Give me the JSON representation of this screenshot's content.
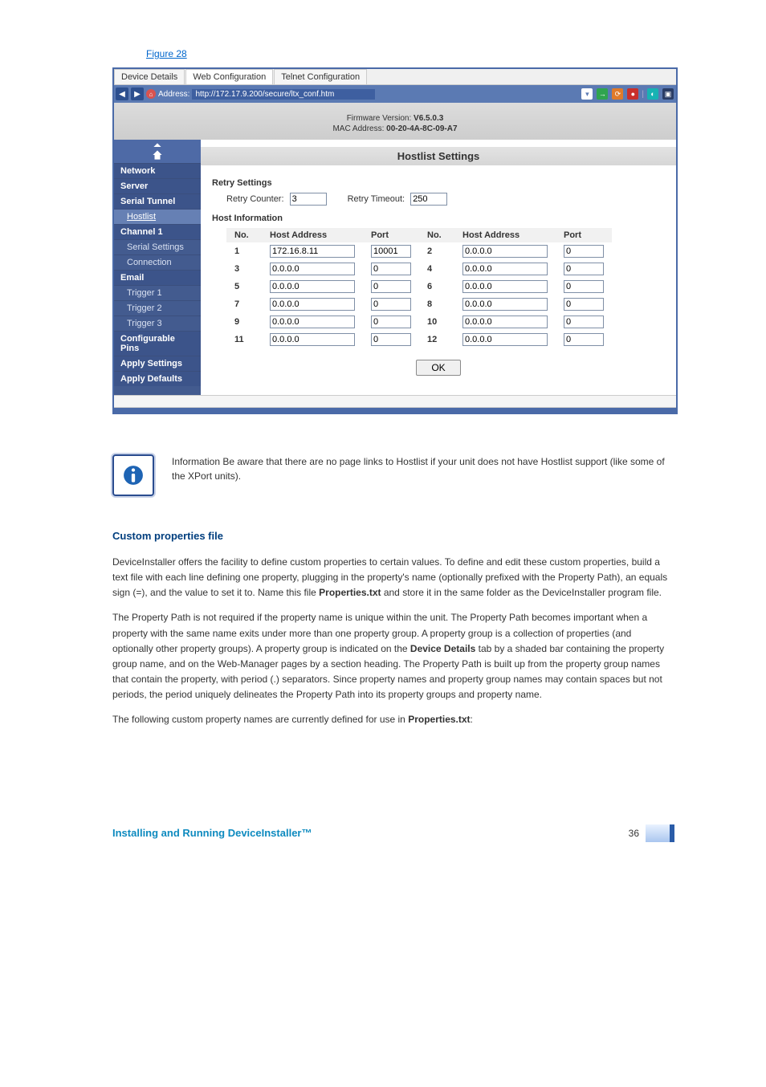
{
  "figure_link": "Figure 28",
  "tabs": {
    "device_details": "Device Details",
    "web_config": "Web Configuration",
    "telnet_config": "Telnet Configuration"
  },
  "addrbar": {
    "label": "Address:",
    "url": "http://172.17.9.200/secure/ltx_conf.htm"
  },
  "meta": {
    "fw_label": "Firmware Version:",
    "fw_value": "V6.5.0.3",
    "mac_label": "MAC Address:",
    "mac_value": "00-20-4A-8C-09-A7"
  },
  "section_title": "Hostlist Settings",
  "sidebar": {
    "network": "Network",
    "server": "Server",
    "serial_tunnel": "Serial Tunnel",
    "hostlist": "Hostlist",
    "channel1": "Channel 1",
    "serial_settings": "Serial Settings",
    "connection": "Connection",
    "email": "Email",
    "trigger1": "Trigger 1",
    "trigger2": "Trigger 2",
    "trigger3": "Trigger 3",
    "cfg_pins": "Configurable Pins",
    "apply_settings": "Apply Settings",
    "apply_defaults": "Apply Defaults"
  },
  "retry": {
    "title": "Retry Settings",
    "counter_label": "Retry Counter:",
    "counter_value": "3",
    "timeout_label": "Retry Timeout:",
    "timeout_value": "250"
  },
  "hostinfo": {
    "title": "Host Information",
    "cols": {
      "no": "No.",
      "ha": "Host Address",
      "port": "Port"
    },
    "rows": [
      {
        "no": "1",
        "ha": "172.16.8.11",
        "port": "10001"
      },
      {
        "no": "2",
        "ha": "0.0.0.0",
        "port": "0"
      },
      {
        "no": "3",
        "ha": "0.0.0.0",
        "port": "0"
      },
      {
        "no": "4",
        "ha": "0.0.0.0",
        "port": "0"
      },
      {
        "no": "5",
        "ha": "0.0.0.0",
        "port": "0"
      },
      {
        "no": "6",
        "ha": "0.0.0.0",
        "port": "0"
      },
      {
        "no": "7",
        "ha": "0.0.0.0",
        "port": "0"
      },
      {
        "no": "8",
        "ha": "0.0.0.0",
        "port": "0"
      },
      {
        "no": "9",
        "ha": "0.0.0.0",
        "port": "0"
      },
      {
        "no": "10",
        "ha": "0.0.0.0",
        "port": "0"
      },
      {
        "no": "11",
        "ha": "0.0.0.0",
        "port": "0"
      },
      {
        "no": "12",
        "ha": "0.0.0.0",
        "port": "0"
      }
    ]
  },
  "ok_label": "OK",
  "note": "Information Be aware that there are no page links to Hostlist if your unit does not have Hostlist support (like some of the XPort units).",
  "custom": {
    "heading": "Custom properties file",
    "p1a": "DeviceInstaller offers the facility to define custom properties to certain values. To define and edit these custom properties, build a text file with each line defining one property, plugging in the property's name (optionally prefixed with the Property Path), an equals sign (=), and the value to set it to. Name this file ",
    "p1b": "Properties.txt",
    "p1c": " and store it in the same folder as the DeviceInstaller program file.",
    "p2a": "The Property Path is not required if the property name is unique within the unit. The Property Path becomes important when a property with the same name exits under more than one property group. A property group is a collection of properties (and optionally other property groups). A property group is indicated on the ",
    "p2b": "Device Details",
    "p2c": " tab by a shaded bar containing the property group name, and on the Web-Manager pages by a section heading. The Property Path is built up from the property group names that contain the property, with period (.) separators. Since property names and property group names may contain spaces but not periods, the period uniquely delineates the Property Path into its property groups and property name.",
    "p3a": "The following custom property names are currently defined for use in ",
    "p3b": "Properties.txt",
    "p3c": ":"
  },
  "footer": {
    "left": "Installing and Running DeviceInstaller™",
    "page": "36"
  },
  "chart_data": {
    "type": "table",
    "title": "Host Information",
    "columns": [
      "No.",
      "Host Address",
      "Port",
      "No.",
      "Host Address",
      "Port"
    ],
    "rows": [
      [
        "1",
        "172.16.8.11",
        "10001",
        "2",
        "0.0.0.0",
        "0"
      ],
      [
        "3",
        "0.0.0.0",
        "0",
        "4",
        "0.0.0.0",
        "0"
      ],
      [
        "5",
        "0.0.0.0",
        "0",
        "6",
        "0.0.0.0",
        "0"
      ],
      [
        "7",
        "0.0.0.0",
        "0",
        "8",
        "0.0.0.0",
        "0"
      ],
      [
        "9",
        "0.0.0.0",
        "0",
        "10",
        "0.0.0.0",
        "0"
      ],
      [
        "11",
        "0.0.0.0",
        "0",
        "12",
        "0.0.0.0",
        "0"
      ]
    ]
  }
}
